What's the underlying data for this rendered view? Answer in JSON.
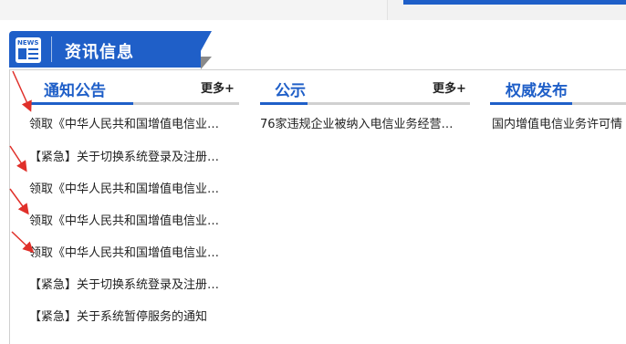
{
  "header": {
    "title": "资讯信息",
    "icon_label": "NEWS"
  },
  "columns": [
    {
      "title": "通知公告",
      "more": "更多+"
    },
    {
      "title": "公示",
      "more": "更多+"
    },
    {
      "title": "权威发布"
    }
  ],
  "notices": [
    "领取《中华人民共和国增值电信业…",
    "【紧急】关于切换系统登录及注册…",
    "领取《中华人民共和国增值电信业…",
    "领取《中华人民共和国增值电信业…",
    "领取《中华人民共和国增值电信业…",
    "【紧急】关于切换系统登录及注册…",
    "【紧急】关于系统暂停服务的通知"
  ],
  "publicity": [
    "76家违规企业被纳入电信业务经营…"
  ],
  "releases": [
    "国内增值电信业务许可情"
  ],
  "colors": {
    "accent": "#1f5fc8",
    "arrow": "#e0302a"
  }
}
